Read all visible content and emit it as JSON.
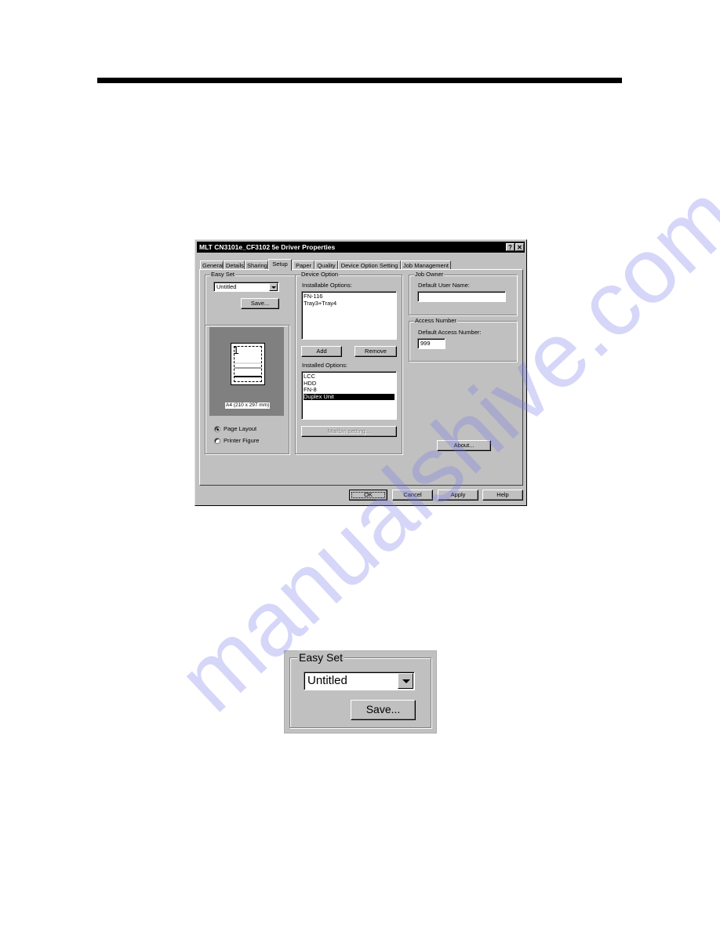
{
  "dialog": {
    "title": "MLT CN3101e_CF3102 5e Driver Properties",
    "help_button": "?",
    "close_button": "✕",
    "tabs": [
      {
        "label": "General"
      },
      {
        "label": "Details"
      },
      {
        "label": "Sharing"
      },
      {
        "label": "Setup",
        "active": true
      },
      {
        "label": "Paper"
      },
      {
        "label": "Quality"
      },
      {
        "label": "Device Option Setting"
      },
      {
        "label": "Job Management"
      }
    ],
    "easy_set": {
      "group_label": "Easy Set",
      "selected": "Untitled",
      "save_label": "Save..."
    },
    "preview": {
      "page_number": "1",
      "paper_size": "A4 (210 x 297 mm)",
      "radios": [
        {
          "label": "Page Layout",
          "checked": true
        },
        {
          "label": "Printer Figure",
          "checked": false
        }
      ]
    },
    "device_option": {
      "group_label": "Device Option",
      "installable_label": "Installable Options:",
      "installable_items": [
        "FN-116",
        "Tray3+Tray4"
      ],
      "add_label": "Add",
      "remove_label": "Remove",
      "installed_label": "Installed Options:",
      "installed_items": [
        "LCC",
        "HDD",
        "FN-8",
        "Duplex Unit"
      ],
      "installed_selected": "Duplex Unit",
      "mailbin_label": "Mailbin setting..."
    },
    "job_owner": {
      "group_label": "Job Owner",
      "user_name_label": "Default User Name:",
      "user_name_value": ""
    },
    "access_number": {
      "group_label": "Access Number",
      "access_label": "Default Access Number:",
      "access_value": "999"
    },
    "about_label": "About...",
    "footer": {
      "ok": "OK",
      "cancel": "Cancel",
      "apply": "Apply",
      "help": "Help"
    }
  },
  "detail": {
    "group_label": "Easy Set",
    "selected": "Untitled",
    "save_label": "Save..."
  },
  "watermark": "manualshive.com",
  "colors": {
    "dialog_face": "#c0c0c0",
    "title_bar": "#000000",
    "preview_bg": "#808080",
    "selection": "#000000",
    "watermark": "#7878eb"
  }
}
